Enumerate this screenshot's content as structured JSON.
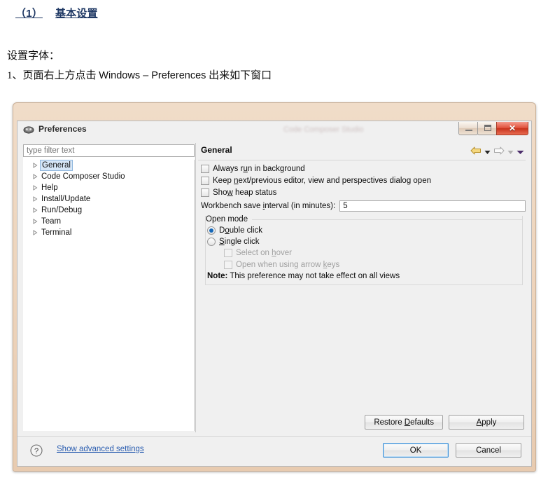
{
  "document": {
    "heading_number": "（1）",
    "heading_text": "基本设置",
    "line1": "设置字体：",
    "line2_prefix": "1、页面右上方点击 ",
    "line2_latin": "Windows – Preferences",
    "line2_suffix": " 出来如下窗口"
  },
  "dialog": {
    "title": "Preferences",
    "ghost_title": "Code Composer Studio",
    "window_controls": {
      "minimize": "Minimize",
      "maximize": "Maximize",
      "close": "✕"
    },
    "filter": {
      "placeholder": "type filter text",
      "value": ""
    },
    "tree": [
      {
        "label": "General",
        "selected": true
      },
      {
        "label": "Code Composer Studio",
        "selected": false
      },
      {
        "label": "Help",
        "selected": false
      },
      {
        "label": "Install/Update",
        "selected": false
      },
      {
        "label": "Run/Debug",
        "selected": false
      },
      {
        "label": "Team",
        "selected": false
      },
      {
        "label": "Terminal",
        "selected": false
      }
    ],
    "page": {
      "title": "General",
      "nav": {
        "back": "back-arrow",
        "back_menu": "back-dropdown",
        "forward": "forward-arrow",
        "forward_menu": "forward-dropdown",
        "view_menu": "view-menu-dropdown"
      },
      "checkboxes": [
        {
          "pre": "Always r",
          "mn": "u",
          "post": "n in background",
          "checked": false,
          "enabled": true
        },
        {
          "pre": "Keep ",
          "mn": "n",
          "post": "ext/previous editor, view and perspectives dialog open",
          "checked": false,
          "enabled": true
        },
        {
          "pre": "Sho",
          "mn": "w",
          "post": " heap status",
          "checked": false,
          "enabled": true
        }
      ],
      "interval": {
        "pre": "Workbench save ",
        "mn": "i",
        "post": "nterval (in minutes):",
        "value": "5"
      },
      "open_mode": {
        "legend": "Open mode",
        "radios": [
          {
            "pre": "D",
            "mn": "o",
            "post": "uble click",
            "checked": true
          },
          {
            "pre": "",
            "mn": "S",
            "post": "ingle click",
            "checked": false
          }
        ],
        "sub_checkboxes": [
          {
            "pre": "Select on ",
            "mn": "h",
            "post": "over",
            "checked": false,
            "enabled": false
          },
          {
            "pre": "Open when using arrow ",
            "mn": "k",
            "post": "eys",
            "checked": false,
            "enabled": false
          }
        ],
        "note_label": "Note:",
        "note_text": "This preference may not take effect on all views"
      },
      "buttons": {
        "restore_pre": "Restore ",
        "restore_mn": "D",
        "restore_post": "efaults",
        "apply_pre": "",
        "apply_mn": "A",
        "apply_post": "pply"
      }
    },
    "footer": {
      "help_icon": "question-mark-icon",
      "advanced_link": "Show advanced settings",
      "ok": "OK",
      "cancel": "Cancel"
    }
  },
  "colors": {
    "heading": "#1f3864",
    "link": "#2a5db0",
    "accent_blue": "#1668b8",
    "frame": "#eed5bd",
    "close_red": "#e0513b",
    "back_arrow_gold": "#e8b93a"
  }
}
